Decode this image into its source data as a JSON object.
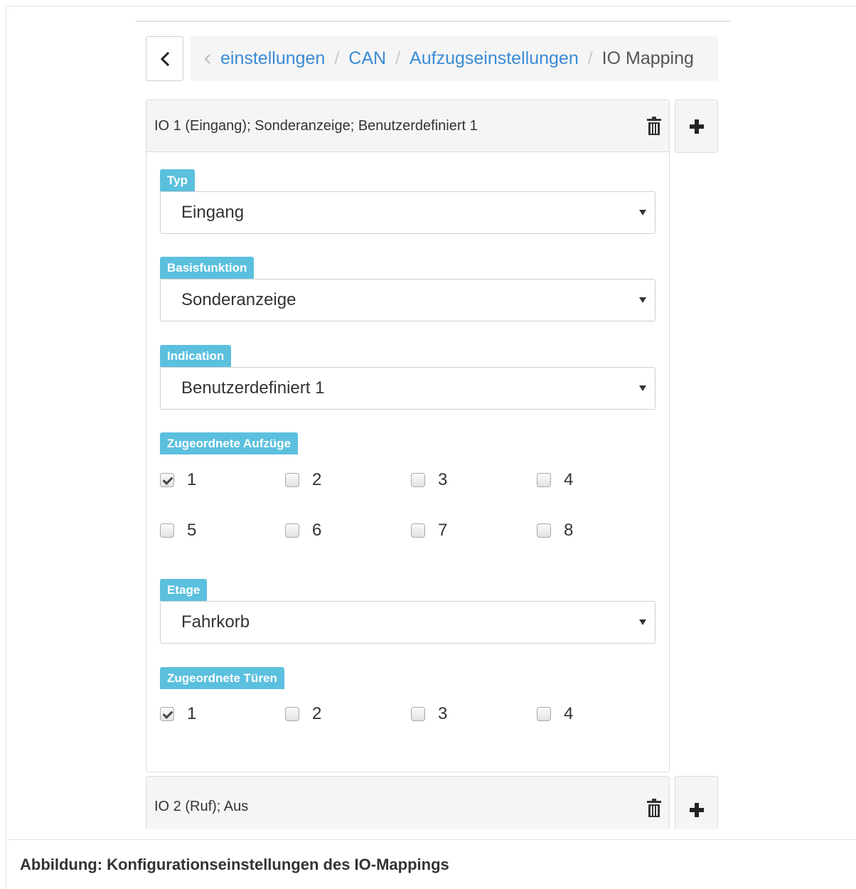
{
  "breadcrumb": {
    "items": [
      "einstellungen",
      "CAN",
      "Aufzugseinstellungen"
    ],
    "active": "IO Mapping",
    "separator": "/"
  },
  "mappings": [
    {
      "title": "IO 1 (Eingang); Sonderanzeige; Benutzerdefiniert 1",
      "expanded": true,
      "fields": {
        "typ": {
          "label": "Typ",
          "value": "Eingang"
        },
        "basisfunktion": {
          "label": "Basisfunktion",
          "value": "Sonderanzeige"
        },
        "indication": {
          "label": "Indication",
          "value": "Benutzerdefiniert 1"
        },
        "etage": {
          "label": "Etage",
          "value": "Fahrkorb"
        }
      },
      "aufzuege": {
        "label": "Zugeordnete Aufzüge",
        "options": [
          {
            "label": "1",
            "checked": true
          },
          {
            "label": "2",
            "checked": false
          },
          {
            "label": "3",
            "checked": false
          },
          {
            "label": "4",
            "checked": false
          },
          {
            "label": "5",
            "checked": false
          },
          {
            "label": "6",
            "checked": false
          },
          {
            "label": "7",
            "checked": false
          },
          {
            "label": "8",
            "checked": false
          }
        ]
      },
      "tueren": {
        "label": "Zugeordnete Türen",
        "options": [
          {
            "label": "1",
            "checked": true
          },
          {
            "label": "2",
            "checked": false
          },
          {
            "label": "3",
            "checked": false
          },
          {
            "label": "4",
            "checked": false
          }
        ]
      }
    },
    {
      "title": "IO 2 (Ruf); Aus",
      "expanded": false
    }
  ],
  "caption": "Abbildung: Konfigurationseinstellungen des IO-Mappings",
  "colors": {
    "link": "#3a8bd6",
    "badge": "#5bc0de",
    "panel_header": "#f5f5f5"
  },
  "icons": {
    "back": "chevron-left-icon",
    "breadcrumb_scroll": "chevron-left-icon",
    "delete": "trash-icon",
    "add": "plus-icon",
    "dropdown": "caret-down-icon"
  }
}
